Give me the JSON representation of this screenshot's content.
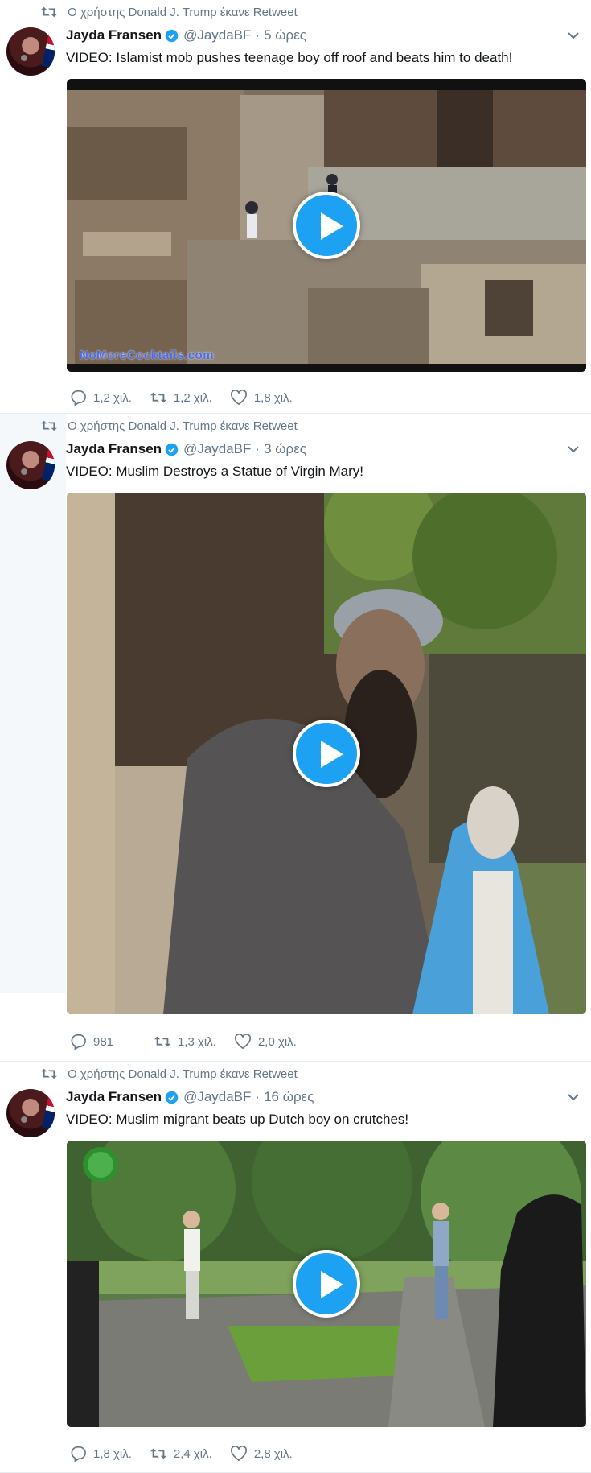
{
  "retweet_context": "Ο χρήστης Donald J. Trump έκανε Retweet",
  "tweets": [
    {
      "name": "Jayda Fransen",
      "handle": "@JaydaBF",
      "separator": "·",
      "time": "5 ώρες",
      "text": "VIDEO: Islamist mob pushes teenage boy off roof and beats him to death!",
      "watermark": "NoMoreCocktails.com",
      "replies": "1,2 χιλ.",
      "retweets": "1,2 χιλ.",
      "likes": "1,8 χιλ."
    },
    {
      "name": "Jayda Fransen",
      "handle": "@JaydaBF",
      "separator": "·",
      "time": "3 ώρες",
      "text": "VIDEO: Muslim Destroys a Statue of Virgin Mary!",
      "replies": "981",
      "retweets": "1,3 χιλ.",
      "likes": "2,0 χιλ."
    },
    {
      "name": "Jayda Fransen",
      "handle": "@JaydaBF",
      "separator": "·",
      "time": "16 ώρες",
      "text": "VIDEO: Muslim migrant beats up Dutch boy on crutches!",
      "replies": "1,8 χιλ.",
      "retweets": "2,4 χιλ.",
      "likes": "2,8 χιλ."
    }
  ],
  "colors": {
    "accent": "#1da1f2",
    "muted": "#657786",
    "text": "#14171a",
    "border": "#e6ecf0"
  },
  "icons": [
    "retweet-icon",
    "verified-badge-icon",
    "chevron-down-icon",
    "play-icon",
    "reply-icon",
    "like-icon"
  ]
}
